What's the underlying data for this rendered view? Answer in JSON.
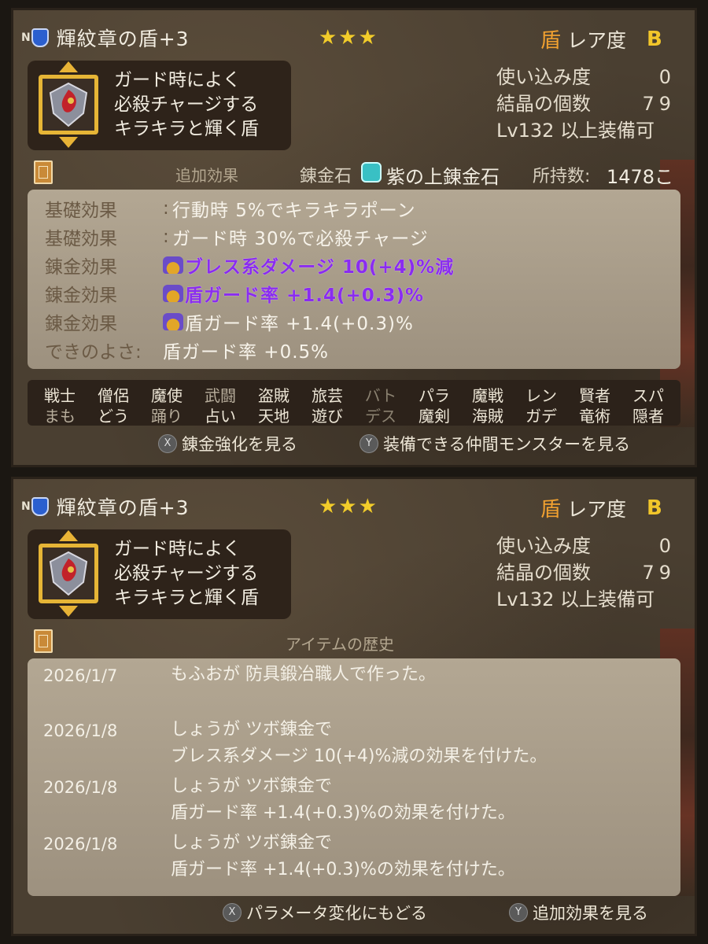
{
  "panel1": {
    "header": {
      "n_badge": "N",
      "item_name": "輝紋章の盾+3",
      "stars": "★★★",
      "rarity_icon": "盾",
      "rarity_label": "レア度",
      "rarity_value": "B"
    },
    "description": [
      "ガード時によく",
      "必殺チャージする",
      "キラキラと輝く盾"
    ],
    "stats": [
      {
        "label": "使い込み度",
        "value": "0"
      },
      {
        "label": "結晶の個数",
        "value": "79"
      },
      {
        "label": "Lv132 以上装備可",
        "value": ""
      }
    ],
    "section_title": "追加効果",
    "rentan_label": "錬金石",
    "ore_name": "紫の上錬金石",
    "owned_label": "所持数:",
    "owned_value": "1478こ",
    "effects": [
      {
        "key": "基礎効果",
        "colon": ":",
        "value": "行動時 5%でキラキラポーン",
        "crown": false,
        "purple": false
      },
      {
        "key": "基礎効果",
        "colon": ":",
        "value": "ガード時 30%で必殺チャージ",
        "crown": false,
        "purple": false
      },
      {
        "key": "錬金効果",
        "colon": "",
        "value": "ブレス系ダメージ 10(+4)%減",
        "crown": true,
        "purple": true
      },
      {
        "key": "錬金効果",
        "colon": "",
        "value": "盾ガード率 +1.4(+0.3)%",
        "crown": true,
        "purple": true
      },
      {
        "key": "錬金効果",
        "colon": "",
        "value": "盾ガード率 +1.4(+0.3)%",
        "crown": true,
        "purple": false
      },
      {
        "key": "できのよさ:",
        "colon": "",
        "value": "盾ガード率 +0.5%",
        "crown": false,
        "purple": false
      }
    ],
    "jobs_top": [
      "戦士",
      "僧侶",
      "魔使",
      "武闘",
      "盗賊",
      "旅芸",
      "バト",
      "パラ",
      "魔戦",
      "レン",
      "賢者",
      "スパ"
    ],
    "jobs_bottom": [
      "まも",
      "どう",
      "踊り",
      "占い",
      "天地",
      "遊び",
      "デス",
      "魔剣",
      "海賊",
      "ガデ",
      "竜術",
      "隠者"
    ],
    "hint_x_button": "X",
    "hint_x": "錬金強化を見る",
    "hint_y_button": "Y",
    "hint_y": "装備できる仲間モンスターを見る"
  },
  "panel2": {
    "header": {
      "n_badge": "N",
      "item_name": "輝紋章の盾+3",
      "stars": "★★★",
      "rarity_icon": "盾",
      "rarity_label": "レア度",
      "rarity_value": "B"
    },
    "description": [
      "ガード時によく",
      "必殺チャージする",
      "キラキラと輝く盾"
    ],
    "stats": [
      {
        "label": "使い込み度",
        "value": "0"
      },
      {
        "label": "結晶の個数",
        "value": "79"
      },
      {
        "label": "Lv132 以上装備可",
        "value": ""
      }
    ],
    "section_title": "アイテムの歴史",
    "history": [
      {
        "date": "2026/1/7",
        "lines": [
          "もふおが 防具鍛冶職人で作った。"
        ]
      },
      {
        "date": "2026/1/8",
        "lines": [
          "しょうが ツボ錬金で",
          "ブレス系ダメージ 10(+4)%減の効果を付けた。"
        ]
      },
      {
        "date": "2026/1/8",
        "lines": [
          "しょうが ツボ錬金で",
          "盾ガード率 +1.4(+0.3)%の効果を付けた。"
        ]
      },
      {
        "date": "2026/1/8",
        "lines": [
          "しょうが ツボ錬金で",
          "盾ガード率 +1.4(+0.3)%の効果を付けた。"
        ]
      }
    ],
    "hint_x_button": "X",
    "hint_x": "パラメータ変化にもどる",
    "hint_y_button": "Y",
    "hint_y": "追加効果を見る"
  }
}
